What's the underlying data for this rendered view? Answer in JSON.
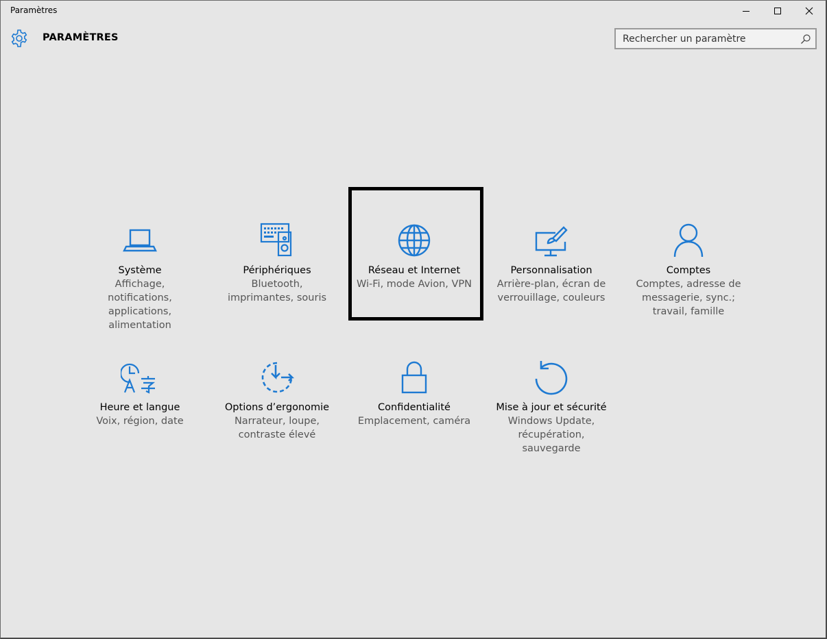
{
  "window": {
    "title": "Paramètres"
  },
  "header": {
    "title": "PARAMÈTRES",
    "icon": "gear-icon",
    "search_placeholder": "Rechercher un paramètre"
  },
  "accent_color": "#1e7ad2",
  "tiles": [
    {
      "icon": "laptop-icon",
      "name": "Système",
      "desc": "Affichage, notifications, applications, alimentation"
    },
    {
      "icon": "keyboard-speaker-icon",
      "name": "Périphériques",
      "desc": "Bluetooth, imprimantes, souris"
    },
    {
      "icon": "globe-icon",
      "name": "Réseau et Internet",
      "desc": "Wi-Fi, mode Avion, VPN",
      "highlighted": true
    },
    {
      "icon": "paintbrush-monitor-icon",
      "name": "Personnalisation",
      "desc": "Arrière-plan, écran de verrouillage, couleurs"
    },
    {
      "icon": "person-icon",
      "name": "Comptes",
      "desc": "Comptes, adresse de messagerie, sync.; travail, famille"
    },
    {
      "icon": "clock-language-icon",
      "name": "Heure et langue",
      "desc": "Voix, région, date"
    },
    {
      "icon": "ease-of-access-icon",
      "name": "Options d’ergonomie",
      "desc": "Narrateur, loupe, contraste élevé"
    },
    {
      "icon": "lock-icon",
      "name": "Confidentialité",
      "desc": "Emplacement, caméra"
    },
    {
      "icon": "refresh-icon",
      "name": "Mise à jour et sécurité",
      "desc": "Windows Update, récupération, sauvegarde"
    }
  ]
}
